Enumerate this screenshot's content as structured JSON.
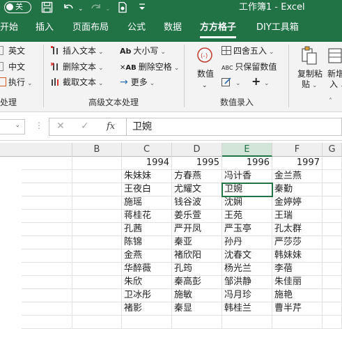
{
  "titlebar": {
    "autosave": "关",
    "title": "工作簿1 - Excel",
    "icons": [
      "save-icon",
      "undo-icon",
      "redo-icon",
      "touch-mode-icon",
      "customize-qat-icon"
    ]
  },
  "tabs": [
    "开始",
    "插入",
    "页面布局",
    "公式",
    "数据",
    "方方格子",
    "DIY工具箱"
  ],
  "ribbon": {
    "left_group": {
      "items": [
        "英文",
        "中文",
        "执行"
      ],
      "label": "处理"
    },
    "adv_text": {
      "col1": [
        "插入文本",
        "删除文本",
        "截取文本"
      ],
      "col2": [
        "大小写",
        "删除空格",
        "更多"
      ],
      "label": "高级文本处理"
    },
    "num_entry": {
      "big": "数值",
      "items": [
        "四舍五入",
        "只保留数值"
      ],
      "label": "数值录入"
    },
    "copy_paste": {
      "line1": "复制粘",
      "line2": "贴"
    },
    "new_add": {
      "line1": "新增",
      "line2": "入"
    }
  },
  "formula": {
    "fx": "fx",
    "value": "卫婉"
  },
  "grid": {
    "columns": [
      "B",
      "C",
      "D",
      "E",
      "F",
      "G"
    ],
    "selected_column": "E",
    "years": [
      "1994",
      "1995",
      "1996",
      "1997"
    ],
    "rows": [
      [
        "朱妹妹",
        "方春燕",
        "冯计香",
        "金兰燕"
      ],
      [
        "王夜白",
        "尤耀文",
        "卫婉",
        "秦勤"
      ],
      [
        "施瑶",
        "钱谷波",
        "沈娴",
        "金婷婷"
      ],
      [
        "蒋桂花",
        "姜乐萱",
        "王苑",
        "王瑞"
      ],
      [
        "孔茜",
        "严开凤",
        "严玉亭",
        "孔太群"
      ],
      [
        "陈锦",
        "秦亚",
        "孙丹",
        "严莎莎"
      ],
      [
        "金燕",
        "褚欣阳",
        "沈春文",
        "韩妹妹"
      ],
      [
        "华醉薇",
        "孔筠",
        "杨光兰",
        "李蓓"
      ],
      [
        "朱欣",
        "秦高彭",
        "邹洪静",
        "朱佳丽"
      ],
      [
        "卫冰彤",
        "施敏",
        "冯月珍",
        "施艳"
      ],
      [
        "褚影",
        "秦显",
        "韩桂兰",
        "曹半芹"
      ]
    ]
  },
  "colors": {
    "accent": "#217346"
  }
}
